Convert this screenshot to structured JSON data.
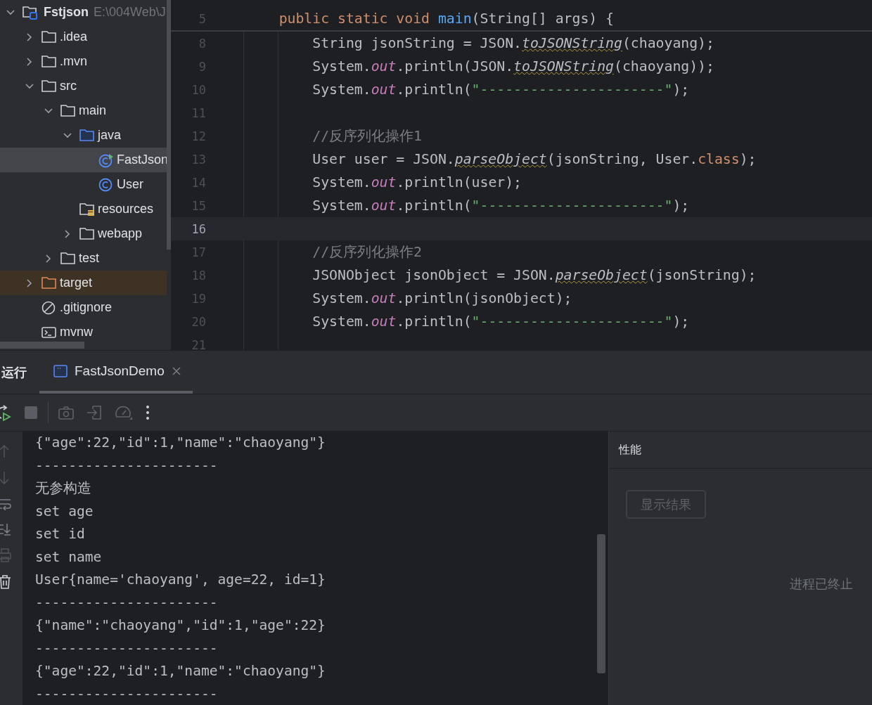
{
  "project_tree": {
    "root": {
      "name": "Fstjson",
      "path": "E:\\004Web\\J",
      "expanded": true
    },
    "items": [
      {
        "name": ".idea",
        "kind": "folder",
        "expanded": false,
        "selected": false
      },
      {
        "name": ".mvn",
        "kind": "folder",
        "expanded": false,
        "selected": false
      },
      {
        "name": "src",
        "kind": "folder",
        "expanded": true,
        "selected": false,
        "children": [
          {
            "name": "main",
            "kind": "folder",
            "expanded": true,
            "selected": false,
            "children": [
              {
                "name": "java",
                "kind": "source-folder",
                "expanded": true,
                "selected": false,
                "children": [
                  {
                    "name": "FastJson",
                    "kind": "run-class",
                    "selected": true
                  },
                  {
                    "name": "User",
                    "kind": "class",
                    "selected": false
                  }
                ]
              },
              {
                "name": "resources",
                "kind": "resources-folder",
                "selected": false
              },
              {
                "name": "webapp",
                "kind": "folder",
                "expanded": false,
                "selected": false
              }
            ]
          },
          {
            "name": "test",
            "kind": "folder",
            "expanded": false,
            "selected": false
          }
        ]
      },
      {
        "name": "target",
        "kind": "excluded-folder",
        "expanded": false,
        "selected": false
      },
      {
        "name": ".gitignore",
        "kind": "ignore",
        "selected": false
      },
      {
        "name": "mvnw",
        "kind": "terminal",
        "selected": false
      }
    ]
  },
  "editor": {
    "sticky_lines": [
      {
        "number": "5",
        "segments": [
          {
            "kind": "keyword",
            "text": "    public static void "
          },
          {
            "kind": "method",
            "text": "main"
          },
          {
            "kind": "plain",
            "text": "(String[] args) {"
          }
        ]
      }
    ],
    "lines": [
      {
        "number": "8",
        "current": false,
        "segments": [
          {
            "kind": "plain",
            "text": "        String jsonString = JSON."
          },
          {
            "kind": "static",
            "text": "toJSONString"
          },
          {
            "kind": "plain",
            "text": "(chaoyang);"
          }
        ]
      },
      {
        "number": "9",
        "current": false,
        "segments": [
          {
            "kind": "plain",
            "text": "        System."
          },
          {
            "kind": "field",
            "text": "out"
          },
          {
            "kind": "plain",
            "text": ".println(JSON."
          },
          {
            "kind": "static",
            "text": "toJSONString"
          },
          {
            "kind": "plain",
            "text": "(chaoyang));"
          }
        ]
      },
      {
        "number": "10",
        "current": false,
        "segments": [
          {
            "kind": "plain",
            "text": "        System."
          },
          {
            "kind": "field",
            "text": "out"
          },
          {
            "kind": "plain",
            "text": ".println("
          },
          {
            "kind": "string",
            "text": "\"----------------------\""
          },
          {
            "kind": "plain",
            "text": ");"
          }
        ]
      },
      {
        "number": "11",
        "current": false
      },
      {
        "number": "12",
        "current": false,
        "segments": [
          {
            "kind": "comment",
            "text": "        //反序列化操作1"
          }
        ]
      },
      {
        "number": "13",
        "current": false,
        "segments": [
          {
            "kind": "plain",
            "text": "        User user = JSON."
          },
          {
            "kind": "static",
            "text": "parseObject"
          },
          {
            "kind": "plain",
            "text": "(jsonString, User."
          },
          {
            "kind": "keyword",
            "text": "class"
          },
          {
            "kind": "plain",
            "text": ");"
          }
        ]
      },
      {
        "number": "14",
        "current": false,
        "segments": [
          {
            "kind": "plain",
            "text": "        System."
          },
          {
            "kind": "field",
            "text": "out"
          },
          {
            "kind": "plain",
            "text": ".println(user);"
          }
        ]
      },
      {
        "number": "15",
        "current": false,
        "segments": [
          {
            "kind": "plain",
            "text": "        System."
          },
          {
            "kind": "field",
            "text": "out"
          },
          {
            "kind": "plain",
            "text": ".println("
          },
          {
            "kind": "string",
            "text": "\"----------------------\""
          },
          {
            "kind": "plain",
            "text": ");"
          }
        ]
      },
      {
        "number": "16",
        "current": true
      },
      {
        "number": "17",
        "current": false,
        "segments": [
          {
            "kind": "comment",
            "text": "        //反序列化操作2"
          }
        ]
      },
      {
        "number": "18",
        "current": false,
        "segments": [
          {
            "kind": "plain",
            "text": "        JSONObject jsonObject = JSON."
          },
          {
            "kind": "static",
            "text": "parseObject"
          },
          {
            "kind": "plain",
            "text": "(jsonString);"
          }
        ]
      },
      {
        "number": "19",
        "current": false,
        "segments": [
          {
            "kind": "plain",
            "text": "        System."
          },
          {
            "kind": "field",
            "text": "out"
          },
          {
            "kind": "plain",
            "text": ".println(jsonObject);"
          }
        ]
      },
      {
        "number": "20",
        "current": false,
        "segments": [
          {
            "kind": "plain",
            "text": "        System."
          },
          {
            "kind": "field",
            "text": "out"
          },
          {
            "kind": "plain",
            "text": ".println("
          },
          {
            "kind": "string",
            "text": "\"----------------------\""
          },
          {
            "kind": "plain",
            "text": ");"
          }
        ]
      },
      {
        "number": "21",
        "current": false
      }
    ]
  },
  "run_panel": {
    "title": "运行",
    "tabs": [
      {
        "label": "FastJsonDemo",
        "selected": true
      }
    ],
    "console": [
      "{\"age\":22,\"id\":1,\"name\":\"chaoyang\"}",
      "----------------------",
      "无参构造",
      "set age",
      "set id",
      "set name",
      "User{name='chaoyang', age=22, id=1}",
      "----------------------",
      "{\"name\":\"chaoyang\",\"id\":1,\"age\":22}",
      "----------------------",
      "{\"age\":22,\"id\":1,\"name\":\"chaoyang\"}",
      "----------------------"
    ],
    "profiler": {
      "title": "性能",
      "button": "显示结果",
      "status": "进程已终止"
    }
  }
}
